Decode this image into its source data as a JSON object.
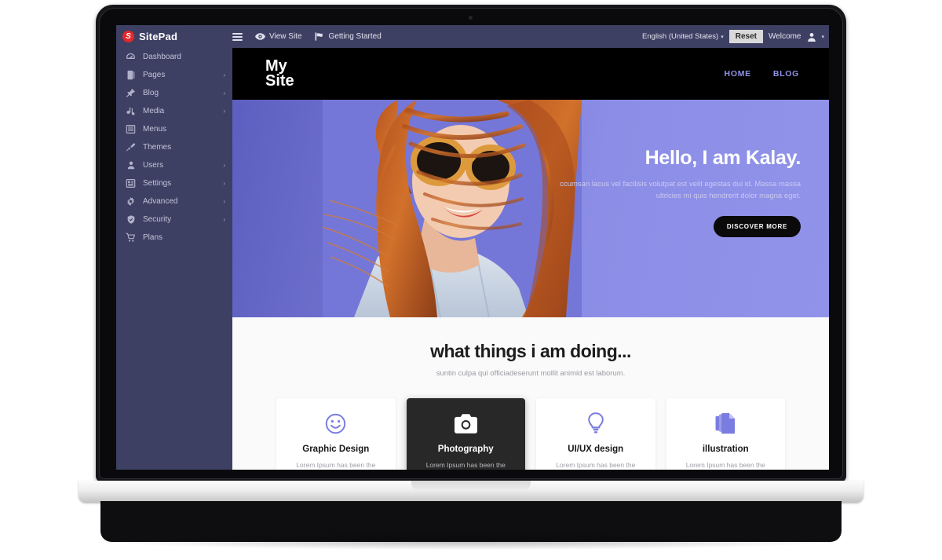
{
  "admin_bar": {
    "brand": "SitePad",
    "brand_logo_letter": "S",
    "menu_icon": "hamburger-icon",
    "view_site": "View Site",
    "view_site_icon": "eye-icon",
    "getting_started": "Getting Started",
    "getting_started_icon": "flag-icon",
    "language": "English (United States)",
    "reset": "Reset",
    "welcome": "Welcome",
    "account_icon": "user-avatar-icon",
    "caret": "▾"
  },
  "sidebar": {
    "items": [
      {
        "label": "Dashboard",
        "icon": "dashboard-gauge-icon",
        "has_submenu": false
      },
      {
        "label": "Pages",
        "icon": "pages-book-icon",
        "has_submenu": true
      },
      {
        "label": "Blog",
        "icon": "pin-icon",
        "has_submenu": true
      },
      {
        "label": "Media",
        "icon": "media-icon",
        "has_submenu": true
      },
      {
        "label": "Menus",
        "icon": "list-icon",
        "has_submenu": false
      },
      {
        "label": "Themes",
        "icon": "brush-icon",
        "has_submenu": false
      },
      {
        "label": "Users",
        "icon": "user-icon",
        "has_submenu": true
      },
      {
        "label": "Settings",
        "icon": "sliders-icon",
        "has_submenu": true
      },
      {
        "label": "Advanced",
        "icon": "gear-icon",
        "has_submenu": true
      },
      {
        "label": "Security",
        "icon": "shield-icon",
        "has_submenu": true
      },
      {
        "label": "Plans",
        "icon": "cart-icon",
        "has_submenu": false
      }
    ],
    "arrow": "›"
  },
  "site": {
    "logo_line1": "My",
    "logo_line2": "Site",
    "nav": [
      {
        "label": "HOME"
      },
      {
        "label": "BLOG"
      }
    ],
    "hero": {
      "title": "Hello, I am Kalay.",
      "subtitle": "ccumsan lacus vel facilisis volutpat est velit egestas dui id. Massa massa ultricies mi quis hendrerit dolor magna eget.",
      "button": "DISCOVER MORE",
      "background_color": "#8a8be4",
      "image_alt": "woman-with-sunglasses-photo"
    },
    "services": {
      "heading": "what things i am doing...",
      "subheading": "suntin culpa qui officiadeserunt mollit animid est laborum.",
      "cards": [
        {
          "title": "Graphic Design",
          "desc": "Lorem Ipsum has been the",
          "icon": "smiley-face-icon",
          "active": false
        },
        {
          "title": "Photography",
          "desc": "Lorem Ipsum has been the",
          "icon": "camera-icon",
          "active": true
        },
        {
          "title": "UI/UX design",
          "desc": "Lorem Ipsum has been the",
          "icon": "lightbulb-icon",
          "active": false
        },
        {
          "title": "illustration",
          "desc": "Lorem Ipsum has been the",
          "icon": "documents-icon",
          "active": false
        }
      ]
    }
  },
  "theme": {
    "admin_bg": "#3d4063",
    "brand_red": "#e5272b",
    "accent_purple": "#6f70d6",
    "site_nav_link": "#8f93e8"
  }
}
